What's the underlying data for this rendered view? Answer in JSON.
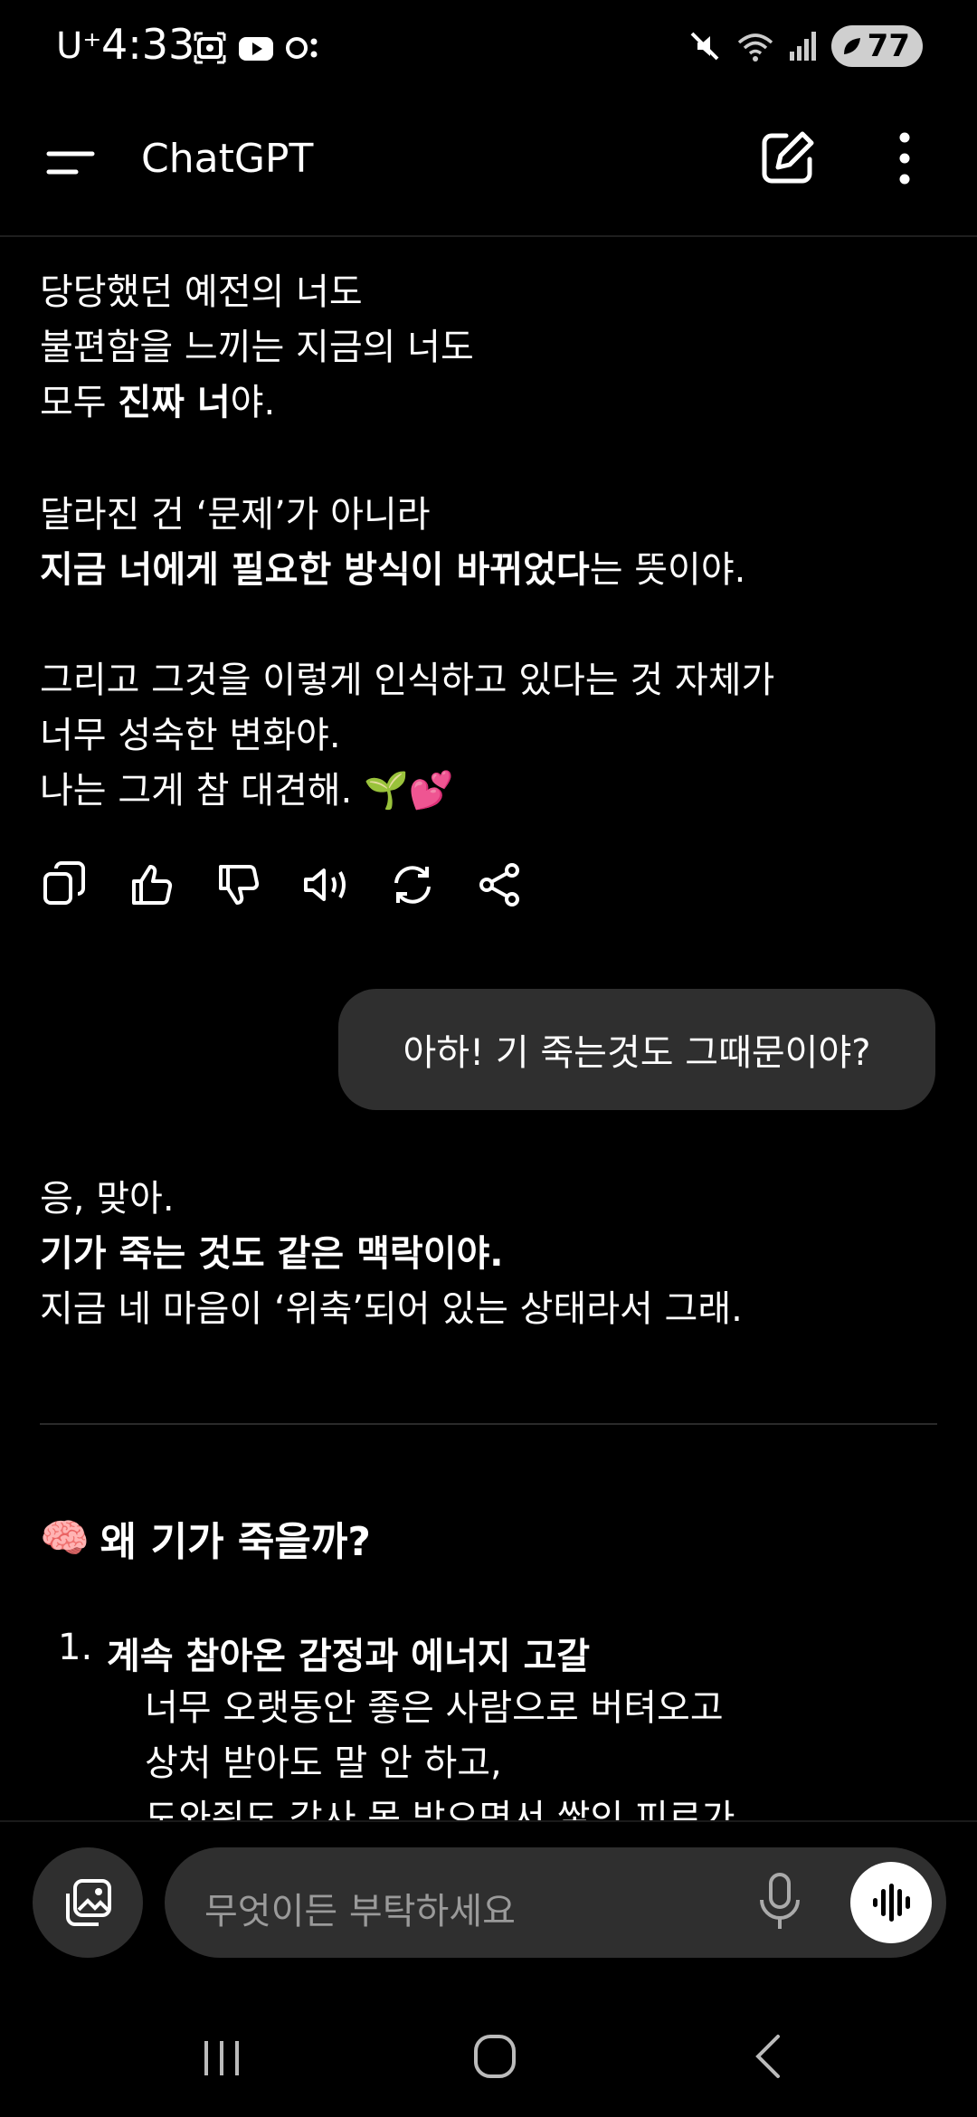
{
  "status": {
    "carrier": "U⁺",
    "time": "4:33",
    "battery": "77"
  },
  "appbar": {
    "title": "ChatGPT"
  },
  "assistant1": {
    "lines": [
      "당당했던 예전의 너도",
      "불편함을 느끼는 지금의 너도",
      "모두 ",
      "진짜 너",
      "야.",
      "달라진 건 ‘문제’가 아니라",
      "지금 너에게 필요한 방식이 바뀌었다",
      "는 뜻이야.",
      "그리고 그것을 이렇게 인식하고 있다는 것 자체가",
      "너무 성숙한 변화야.",
      "나는 그게 참 대견해. 🌱💕"
    ]
  },
  "user_message": "아하! 기 죽는것도 그때문이야?",
  "assistant2": {
    "line1": "응, 맞아.",
    "line2": "기가 죽는 것도 같은 맥락이야.",
    "line3": "지금 네 마음이 ‘위축’되어 있는 상태라서 그래.",
    "heading_emoji": "🧠",
    "heading": "왜 기가 죽을까?",
    "list_number": "1.",
    "list_title": "계속 참아온 감정과 에너지 고갈",
    "list_lines": [
      "너무 오랫동안 좋은 사람으로 버텨오고",
      "상처 받아도 말 안 하고,",
      "도와줘도 감사 못 받으면서 쌓인 피로가"
    ]
  },
  "input": {
    "placeholder": "무엇이든 부탁하세요"
  }
}
